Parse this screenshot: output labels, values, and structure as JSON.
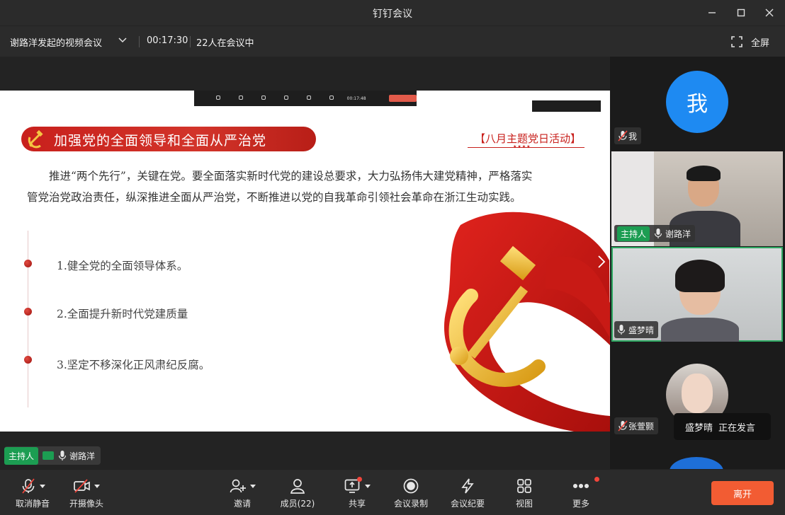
{
  "window": {
    "title": "钉钉会议"
  },
  "infobar": {
    "meeting_name": "谢路洋发起的视频会议",
    "duration": "00:17:30",
    "participants_text": "22人在会议中",
    "fullscreen_label": "全屏"
  },
  "slide": {
    "heading": "加强党的全面领导和全面从严治党",
    "activity_label": "【八月主题党日活动】",
    "paragraph": "推进“两个先行”，关键在党。要全面落实新时代党的建设总要求，大力弘扬伟大建党精神，严格落实管党治党政治责任，纵深推进全面从严治党，不断推进以党的自我革命引领社会革命在浙江生动实践。",
    "items": [
      "1.健全党的全面领导体系。",
      "2.全面提升新时代党建质量",
      "3.坚定不移深化正风肃纪反腐。"
    ],
    "mini_toolbar_time": "00:17:48"
  },
  "stage_footer": {
    "host_tag": "主持人",
    "host_name": "谢路洋"
  },
  "participants": [
    {
      "avatar_text": "我",
      "name": "我",
      "host": false
    },
    {
      "name": "谢路洋",
      "host": true,
      "host_tag": "主持人"
    },
    {
      "name": "盛梦晴",
      "host": false
    },
    {
      "name": "张萱颢",
      "host": false
    }
  ],
  "speaking": {
    "name": "盛梦晴",
    "status": "正在发言"
  },
  "toolbar": {
    "unmute": "取消静音",
    "camera": "开摄像头",
    "invite": "邀请",
    "members": "成员(22)",
    "share": "共享",
    "record": "会议录制",
    "minutes": "会议纪要",
    "view": "视图",
    "more": "更多",
    "leave": "离开"
  },
  "colors": {
    "accent_red": "#c8201c",
    "host_green": "#1c9d52",
    "leave_orange": "#f25c33",
    "avatar_blue": "#1e8af2"
  }
}
